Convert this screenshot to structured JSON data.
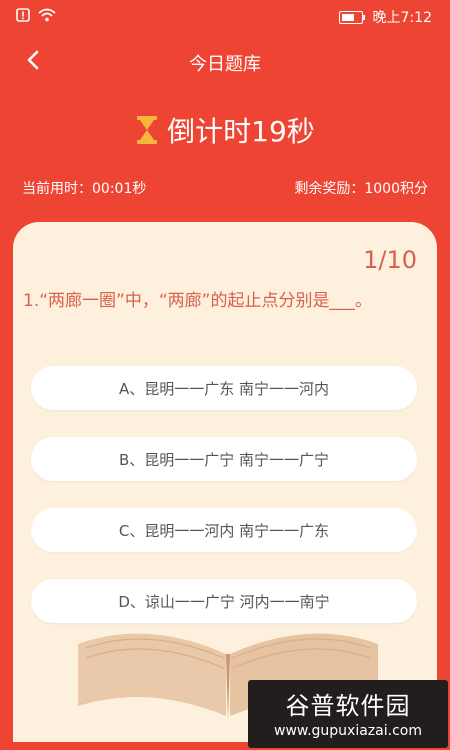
{
  "statusbar": {
    "time": "晚上7:12"
  },
  "header": {
    "title": "今日题库"
  },
  "timer": {
    "text": "倒计时19秒"
  },
  "info": {
    "elapsed": "当前用时：00:01秒",
    "reward": "剩余奖励：1000积分"
  },
  "question": {
    "counter": "1/10",
    "text": "1.“两廊一圈”中，“两廊”的起止点分别是___。"
  },
  "options": [
    {
      "label": "A、昆明一一广东 南宁一一河内"
    },
    {
      "label": "B、昆明一一广宁 南宁一一广宁"
    },
    {
      "label": "C、昆明一一河内 南宁一一广东"
    },
    {
      "label": "D、谅山一一广宁 河内一一南宁"
    }
  ],
  "watermark": {
    "name": "谷普软件园",
    "url": "www.gupuxiazai.com"
  }
}
